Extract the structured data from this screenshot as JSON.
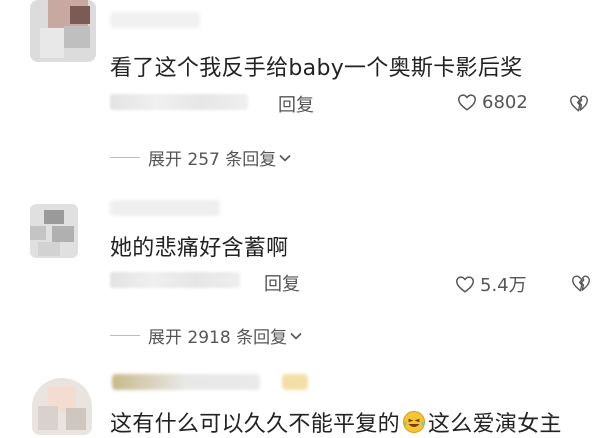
{
  "comments": [
    {
      "text": "看了这个我反手给baby一个奥斯卡影后奖",
      "reply_label": "回复",
      "likes": "6802",
      "expand_label": "展开 257 条回复",
      "icons": {
        "like": "heart-outline-icon",
        "dislike": "broken-heart-icon",
        "expand": "chevron-down-icon"
      }
    },
    {
      "text": "她的悲痛好含蓄啊",
      "reply_label": "回复",
      "likes": "5.4万",
      "expand_label": "展开 2918 条回复",
      "icons": {
        "like": "heart-outline-icon",
        "dislike": "broken-heart-icon",
        "expand": "chevron-down-icon"
      }
    },
    {
      "text_before": "这有什么可以久久不能平复的",
      "emoji": "laughing-crying-emoji",
      "text_after": "这么爱演女主"
    }
  ],
  "colors": {
    "text": "#222222",
    "secondary": "#555555",
    "divider": "#bdbdbd"
  }
}
